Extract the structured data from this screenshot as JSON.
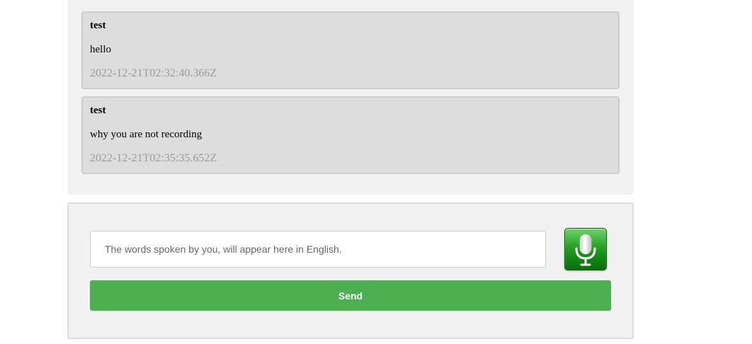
{
  "messages": [
    {
      "user": "test",
      "text": "hello",
      "timestamp": "2022-12-21T02:32:40.366Z"
    },
    {
      "user": "test",
      "text": "why you are not recording",
      "timestamp": "2022-12-21T02:35:35.652Z"
    }
  ],
  "composer": {
    "placeholder": "The words spoken by you, will appear here in English.",
    "value": "",
    "send_label": "Send",
    "mic_icon": "microphone-icon"
  },
  "colors": {
    "panel_bg": "#f1f1f1",
    "message_bg": "#dddddd",
    "timestamp": "#9a9a9a",
    "send_button": "#4caf50",
    "mic_button": "#138a13"
  }
}
